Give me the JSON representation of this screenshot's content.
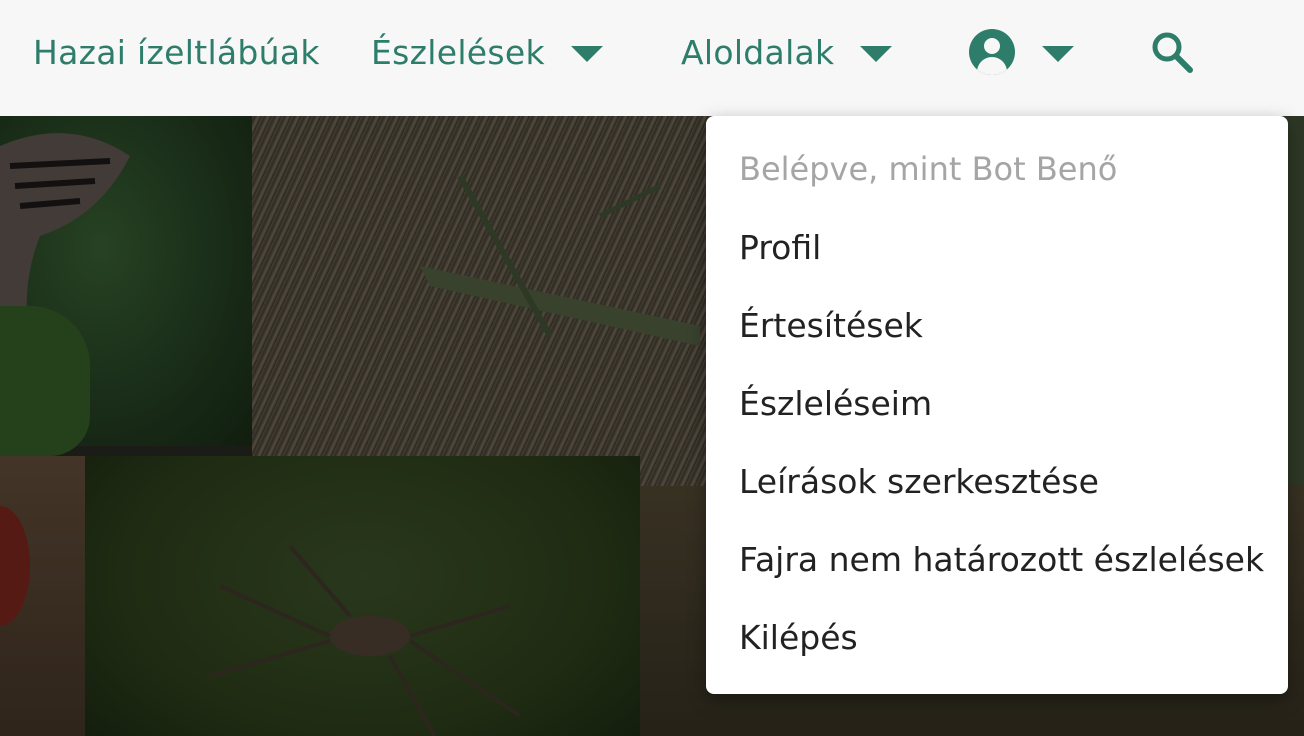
{
  "navbar": {
    "brand": "Hazai ízeltlábúak",
    "observations_label": "Észlelések",
    "subpages_label": "Aloldalak",
    "user_icon": "account-circle-icon",
    "search_icon": "search-icon"
  },
  "user_menu": {
    "header": "Belépve, mint Bot Benő",
    "items": [
      "Profil",
      "Értesítések",
      "Észleléseim",
      "Leírások szerkesztése",
      "Fajra nem határozott észlelések",
      "Kilépés"
    ]
  },
  "colors": {
    "accent": "#2e7d6b",
    "navbar_bg": "#f7f7f7"
  }
}
